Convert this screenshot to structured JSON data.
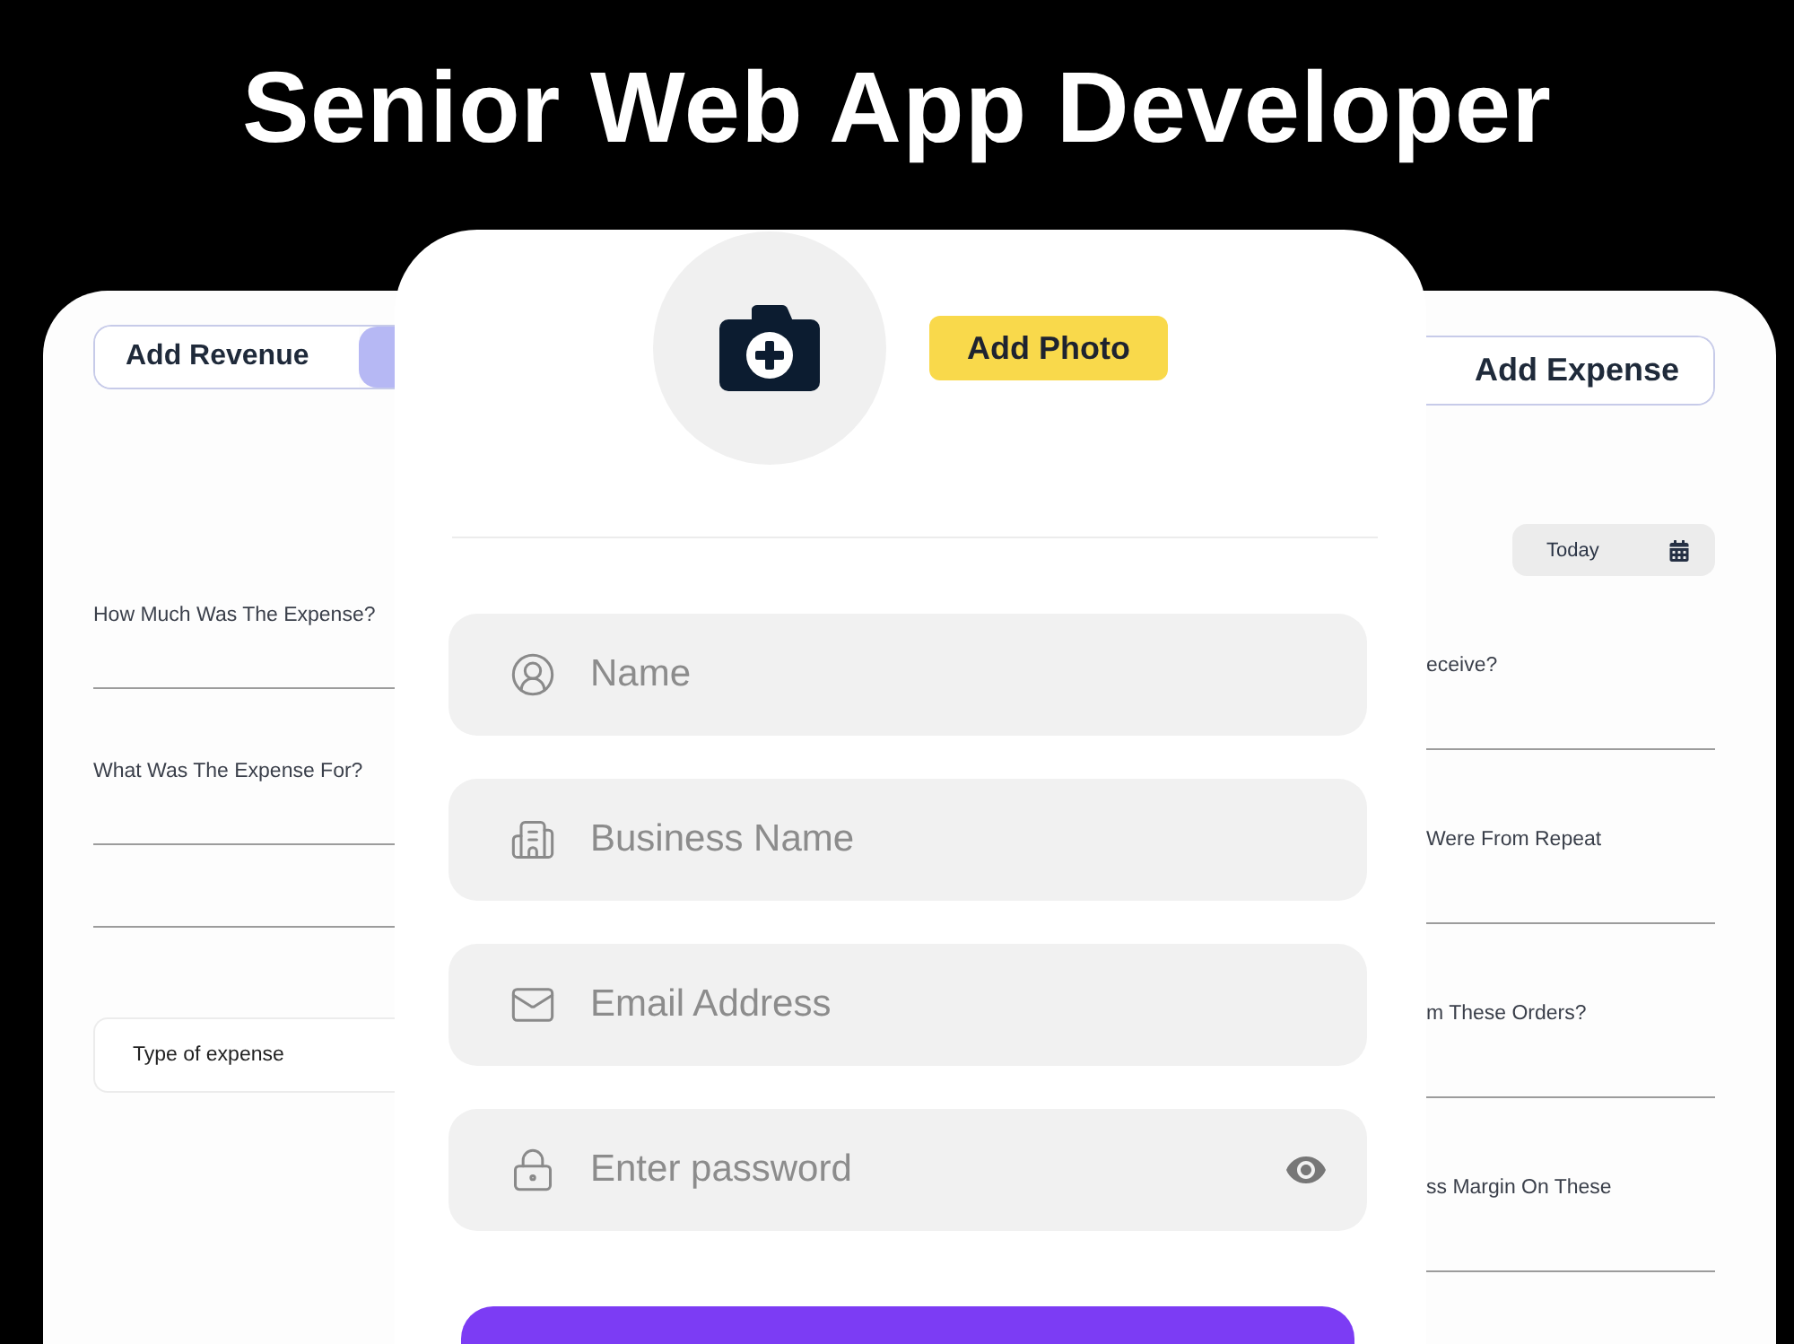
{
  "headline": "Senior Web App Developer",
  "left_card": {
    "toggle": [
      {
        "label": "Add Revenue",
        "selected": false
      },
      {
        "selected": true
      }
    ],
    "items": [
      {
        "kind": "question",
        "label": "How Much Was The Expense?"
      },
      {
        "kind": "question",
        "label": "What Was The Expense For?"
      },
      {
        "kind": "blank"
      }
    ],
    "dropdown": {
      "value": "Type of expense"
    }
  },
  "center_card": {
    "photo_button": "Add Photo",
    "fields": [
      {
        "kind": "name",
        "placeholder": "Name"
      },
      {
        "kind": "business",
        "placeholder": "Business Name"
      },
      {
        "kind": "email",
        "placeholder": "Email Address"
      },
      {
        "kind": "password",
        "placeholder": "Enter password"
      }
    ],
    "submit_button": {
      "kind": "primary"
    }
  },
  "right_card": {
    "toggle": [
      {
        "label": "Add Expense",
        "selected": false
      }
    ],
    "date": {
      "value": "Today"
    },
    "items": [
      {
        "kind": "question",
        "label": "eceive?"
      },
      {
        "kind": "question",
        "label": "Were From Repeat"
      },
      {
        "kind": "question",
        "label": "m These Orders?"
      },
      {
        "kind": "question",
        "label": "ss Margin On These"
      }
    ]
  }
}
